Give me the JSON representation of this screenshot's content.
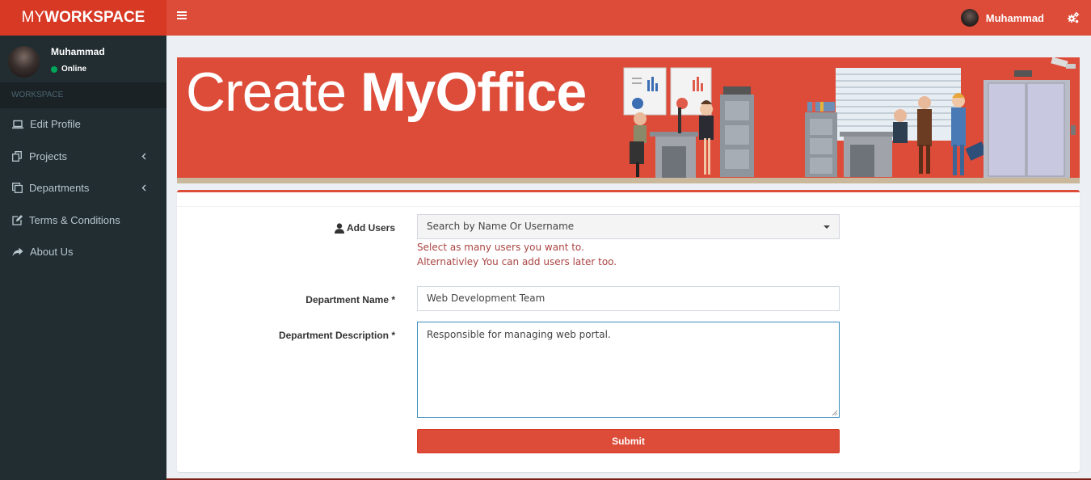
{
  "brand": {
    "light": "MY",
    "bold": "WORKSPACE"
  },
  "header": {
    "username": "Muhammad"
  },
  "sidebar": {
    "user": {
      "name": "Muhammad",
      "status": "Online"
    },
    "section_header": "WORKSPACE",
    "items": [
      {
        "label": "Edit Profile",
        "icon": "laptop-icon"
      },
      {
        "label": "Projects",
        "icon": "copy-icon",
        "has_chevron": true
      },
      {
        "label": "Departments",
        "icon": "files-icon",
        "has_chevron": true
      },
      {
        "label": "Terms & Conditions",
        "icon": "edit-icon"
      },
      {
        "label": "About Us",
        "icon": "share-icon"
      }
    ]
  },
  "banner": {
    "title_light": "Create ",
    "title_bold": "MyOffice"
  },
  "form": {
    "add_users": {
      "label": "Add Users",
      "placeholder": "Search by Name Or Username",
      "help_line1": "Select as many users you want to.",
      "help_line2": "Alternativley You can add users later too."
    },
    "department_name": {
      "label": "Department Name *",
      "value": "Web Development Team"
    },
    "department_description": {
      "label": "Department Description *",
      "value": "Responsible for managing web portal."
    },
    "submit_label": "Submit"
  },
  "colors": {
    "primary": "#dd4b39",
    "primary_dark": "#d73925",
    "sidebar": "#222d32",
    "sidebar_header": "#1a2226",
    "help_text": "#a94442",
    "focus": "#3c8dbc"
  }
}
